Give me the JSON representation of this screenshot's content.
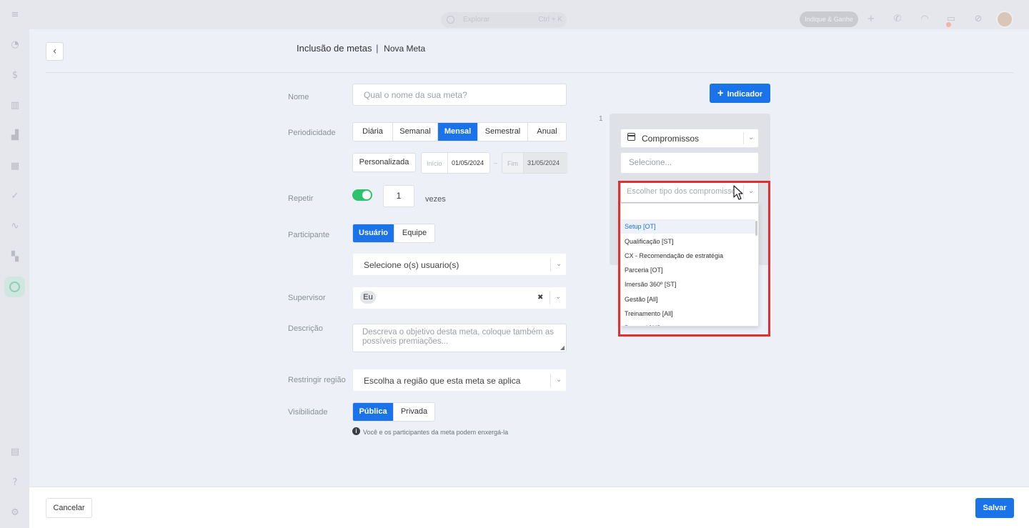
{
  "topbar": {
    "explore_label": "Explorar",
    "explore_shortcut": "Ctrl + K",
    "indique_label": "Indique & Ganhe"
  },
  "modal": {
    "title": "Inclusão de metas",
    "separator": "|",
    "subtitle": "Nova Meta"
  },
  "form": {
    "nome": {
      "label": "Nome",
      "placeholder": "Qual o nome da sua meta?"
    },
    "periodicidade": {
      "label": "Periodicidade",
      "options": [
        "Diária",
        "Semanal",
        "Mensal",
        "Semestral",
        "Anual"
      ],
      "selected": "Mensal",
      "custom_label": "Personalizada",
      "inicio_label": "Início",
      "inicio_value": "01/05/2024",
      "range_sep": "–",
      "fim_label": "Fim",
      "fim_value": "31/05/2024"
    },
    "repetir": {
      "label": "Repetir",
      "enabled": true,
      "value": "1",
      "suffix": "vezes"
    },
    "participante": {
      "label": "Participante",
      "options": [
        "Usuário",
        "Equipe"
      ],
      "selected": "Usuário",
      "select_placeholder": "Selecione o(s) usuario(s)"
    },
    "supervisor": {
      "label": "Supervisor",
      "chip": "Eu",
      "clear": "✖"
    },
    "descricao": {
      "label": "Descrição",
      "placeholder": "Descreva o objetivo desta meta, coloque também as possíveis premiações..."
    },
    "regiao": {
      "label": "Restringir região",
      "placeholder": "Escolha a região que esta meta se aplica"
    },
    "visibilidade": {
      "label": "Visibilidade",
      "options": [
        "Pública",
        "Privada"
      ],
      "selected": "Pública",
      "info": "Você e os participantes da meta podem enxergá-la"
    }
  },
  "indicator": {
    "add_button": "Indicador",
    "add_icon": "+",
    "index": "1",
    "type_value": "Compromissos",
    "select_placeholder": "Selecione...",
    "tipo_placeholder": "Escolher tipo dos compromissos",
    "dropdown_items": [
      "Setup [OT]",
      "Qualificação [ST]",
      "CX - Recomendação de estratégia",
      "Parceria [OT]",
      "Imersão 360º [ST]",
      "Gestão [All]",
      "Treinamento [All]",
      "Pessoal [All]"
    ],
    "highlighted_index": 0
  },
  "footer": {
    "cancel": "Cancelar",
    "save": "Salvar"
  },
  "colors": {
    "primary": "#1a73e8",
    "toggle_on": "#2dc36a",
    "highlight_box": "#e03131"
  }
}
